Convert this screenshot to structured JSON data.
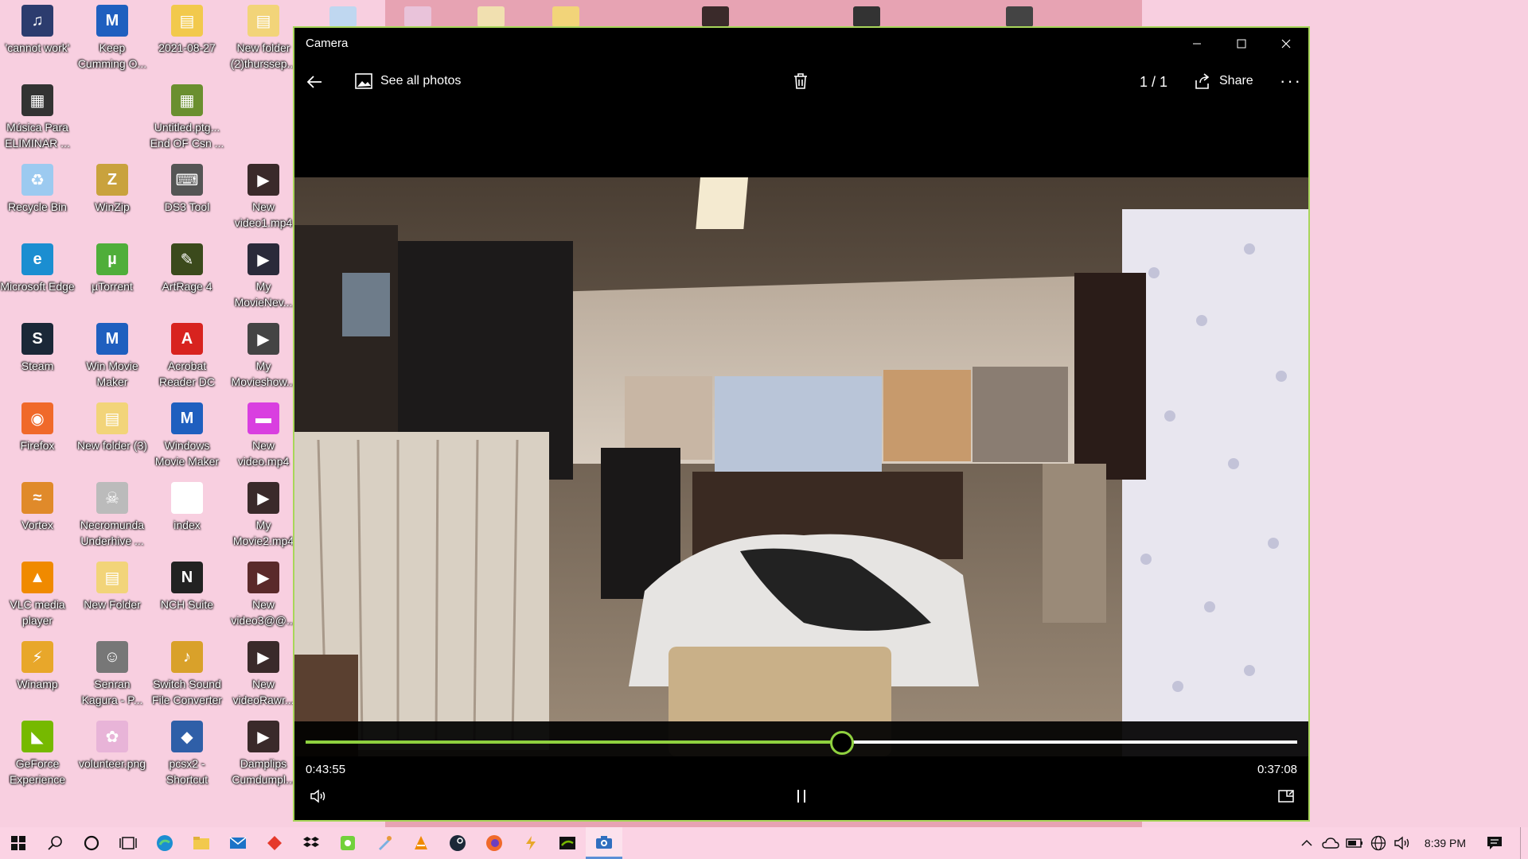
{
  "desktop": {
    "icons": [
      {
        "label": "'cannot work'",
        "color": "#2c3c6e",
        "glyph": "♫"
      },
      {
        "label": "Keep Cumming O...",
        "color": "#1f5fbf",
        "glyph": "M"
      },
      {
        "label": "2021-08-27",
        "color": "#f2c94c",
        "glyph": "▤"
      },
      {
        "label": "New folder (2)thurssep...",
        "color": "#f2d479",
        "glyph": "▤"
      },
      {
        "label": "Música Para ELIMINAR ...",
        "color": "#333333",
        "glyph": "▦"
      },
      {
        "label": "Untitled.ptg... End OF Csn ...",
        "color": "#6a8f2f",
        "glyph": "▦"
      },
      {
        "label": "Recycle Bin",
        "color": "#9ccaf0",
        "glyph": "♻"
      },
      {
        "label": "WinZip",
        "color": "#c9a23d",
        "glyph": "Z"
      },
      {
        "label": "DS3 Tool",
        "color": "#555555",
        "glyph": "⌨"
      },
      {
        "label": "New video1.mp4",
        "color": "#3a2a2a",
        "glyph": "▶"
      },
      {
        "label": "Microsoft Edge",
        "color": "#1b8ed1",
        "glyph": "e"
      },
      {
        "label": "µTorrent",
        "color": "#4fae3a",
        "glyph": "µ"
      },
      {
        "label": "ArtRage 4",
        "color": "#3b4a1c",
        "glyph": "✎"
      },
      {
        "label": "My MovieNev...",
        "color": "#2a2a3a",
        "glyph": "▶"
      },
      {
        "label": "Steam",
        "color": "#1b2838",
        "glyph": "S"
      },
      {
        "label": "Win Movie Maker",
        "color": "#1f5fbf",
        "glyph": "M"
      },
      {
        "label": "Acrobat Reader DC",
        "color": "#d8231f",
        "glyph": "A"
      },
      {
        "label": "My Movieshow...",
        "color": "#444444",
        "glyph": "▶"
      },
      {
        "label": "Firefox",
        "color": "#f0692a",
        "glyph": "◉"
      },
      {
        "label": "New folder (3)",
        "color": "#f2d479",
        "glyph": "▤"
      },
      {
        "label": "Windows Movie Maker",
        "color": "#1f5fbf",
        "glyph": "M"
      },
      {
        "label": "New video.mp4",
        "color": "#d93fe0",
        "glyph": "▬"
      },
      {
        "label": "Vortex",
        "color": "#e08a2a",
        "glyph": "≈"
      },
      {
        "label": "Necromunda Underhive ...",
        "color": "#bbbbbb",
        "glyph": "☠"
      },
      {
        "label": "index",
        "color": "#ffffff",
        "glyph": "▯"
      },
      {
        "label": "My Movie2.mp4",
        "color": "#3a2a2a",
        "glyph": "▶"
      },
      {
        "label": "VLC media player",
        "color": "#f08a00",
        "glyph": "▲"
      },
      {
        "label": "New Folder",
        "color": "#f2d479",
        "glyph": "▤"
      },
      {
        "label": "NCH Suite",
        "color": "#222222",
        "glyph": "N"
      },
      {
        "label": "New video3@@...",
        "color": "#5a2a2a",
        "glyph": "▶"
      },
      {
        "label": "Winamp",
        "color": "#e8a72a",
        "glyph": "⚡"
      },
      {
        "label": "Senran Kagura - P...",
        "color": "#777777",
        "glyph": "☺"
      },
      {
        "label": "Switch Sound File Converter",
        "color": "#d9a12a",
        "glyph": "♪"
      },
      {
        "label": "New videoRawr...",
        "color": "#3a2a2a",
        "glyph": "▶"
      },
      {
        "label": "GeForce Experience",
        "color": "#76b900",
        "glyph": "◣"
      },
      {
        "label": "volunteer.png",
        "color": "#e8b4d8",
        "glyph": "✿"
      },
      {
        "label": "pcsx2 - Shortcut",
        "color": "#2f5fa8",
        "glyph": "◆"
      },
      {
        "label": "Damplips Cumdumpl...",
        "color": "#3a2a2a",
        "glyph": "▶"
      }
    ]
  },
  "window": {
    "title": "Camera",
    "minimize_icon": "minimize-icon",
    "maximize_icon": "maximize-icon",
    "close_icon": "close-icon",
    "accent": "#8fd13f"
  },
  "toolbar": {
    "see_all_photos": "See all photos",
    "counter": "1 / 1",
    "share": "Share"
  },
  "video": {
    "elapsed": "0:43:55",
    "remaining": "0:37:08",
    "progress_percent": 54
  },
  "taskbar": {
    "time": "8:39 PM"
  }
}
